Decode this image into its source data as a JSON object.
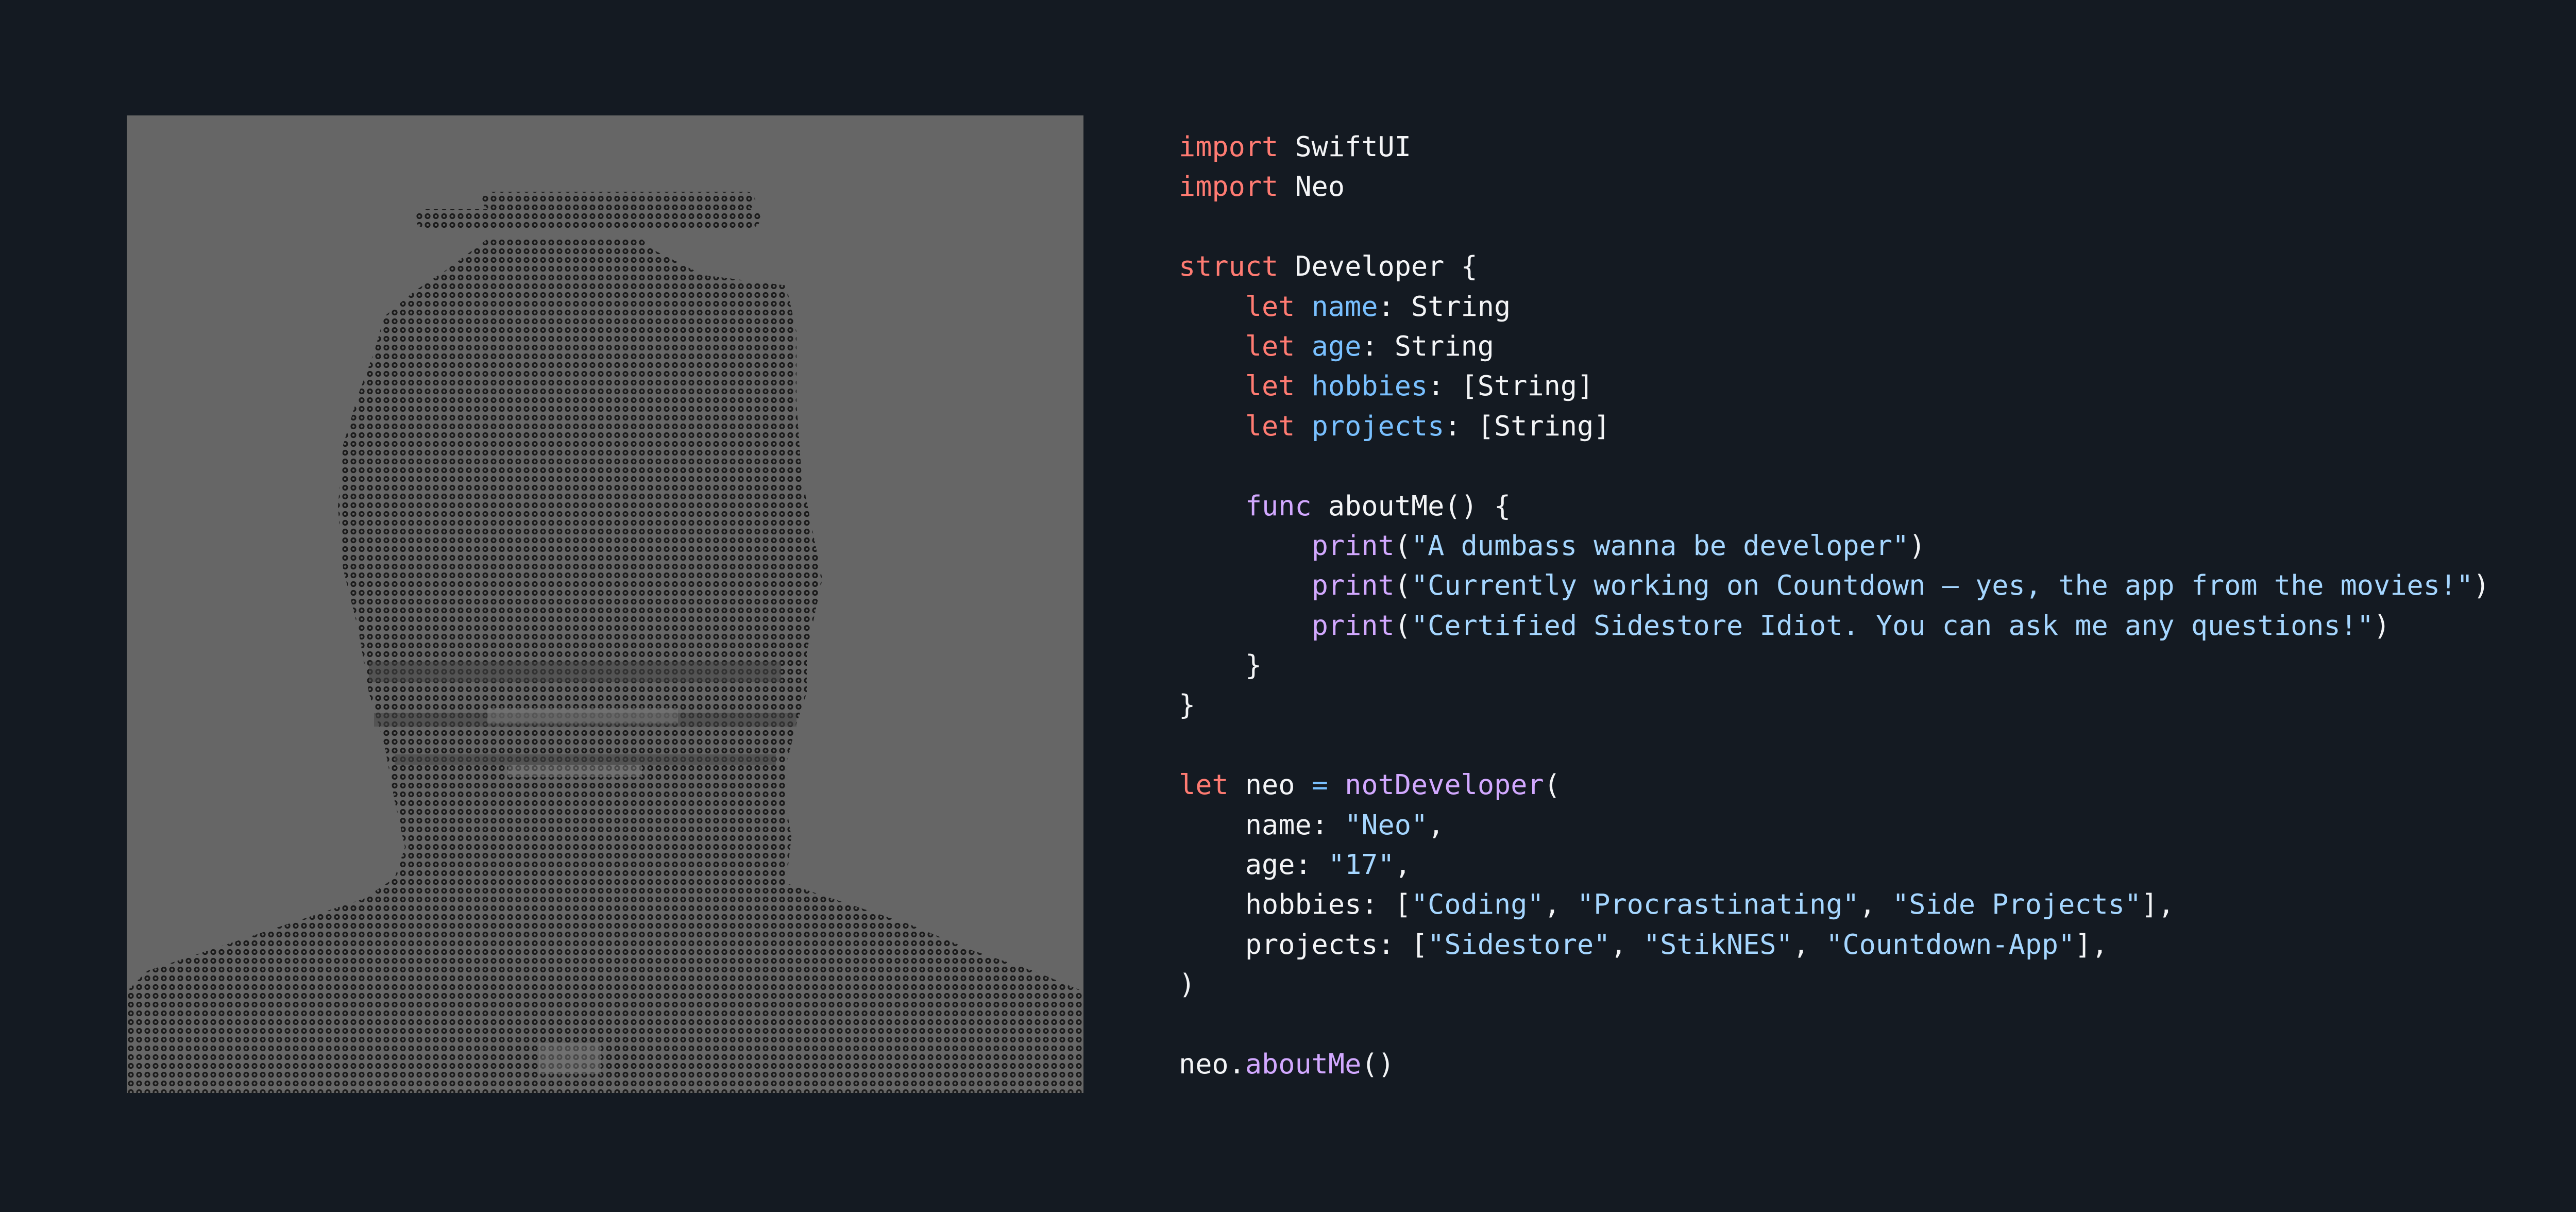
{
  "colors": {
    "background": "#141a22",
    "image_background": "#666666",
    "ascii_art": "#1a1a1a",
    "keyword": "#ff7b72",
    "function": "#d2a8ff",
    "property": "#79c0ff",
    "string": "#a5d6ff",
    "plain": "#f3f4f6"
  },
  "avatar": {
    "kind": "ascii-art-portrait",
    "icon": "ascii-portrait-icon"
  },
  "code": {
    "language": "swift",
    "lines": [
      [
        {
          "t": "import",
          "c": "kw"
        },
        {
          "t": " SwiftUI",
          "c": "plain"
        }
      ],
      [
        {
          "t": "import",
          "c": "kw"
        },
        {
          "t": " Neo",
          "c": "plain"
        }
      ],
      [],
      [
        {
          "t": "struct",
          "c": "kw"
        },
        {
          "t": " Developer {",
          "c": "plain"
        }
      ],
      [
        {
          "t": "    ",
          "c": "plain"
        },
        {
          "t": "let",
          "c": "kw"
        },
        {
          "t": " ",
          "c": "plain"
        },
        {
          "t": "name",
          "c": "prop"
        },
        {
          "t": ": String",
          "c": "plain"
        }
      ],
      [
        {
          "t": "    ",
          "c": "plain"
        },
        {
          "t": "let",
          "c": "kw"
        },
        {
          "t": " ",
          "c": "plain"
        },
        {
          "t": "age",
          "c": "prop"
        },
        {
          "t": ": String",
          "c": "plain"
        }
      ],
      [
        {
          "t": "    ",
          "c": "plain"
        },
        {
          "t": "let",
          "c": "kw"
        },
        {
          "t": " ",
          "c": "plain"
        },
        {
          "t": "hobbies",
          "c": "prop"
        },
        {
          "t": ": [String]",
          "c": "plain"
        }
      ],
      [
        {
          "t": "    ",
          "c": "plain"
        },
        {
          "t": "let",
          "c": "kw"
        },
        {
          "t": " ",
          "c": "plain"
        },
        {
          "t": "projects",
          "c": "prop"
        },
        {
          "t": ": [String]",
          "c": "plain"
        }
      ],
      [],
      [
        {
          "t": "    ",
          "c": "plain"
        },
        {
          "t": "func",
          "c": "fn"
        },
        {
          "t": " aboutMe() {",
          "c": "plain"
        }
      ],
      [
        {
          "t": "        ",
          "c": "plain"
        },
        {
          "t": "print",
          "c": "fn"
        },
        {
          "t": "(",
          "c": "plain"
        },
        {
          "t": "\"A dumbass wanna be developer\"",
          "c": "str"
        },
        {
          "t": ")",
          "c": "plain"
        }
      ],
      [
        {
          "t": "        ",
          "c": "plain"
        },
        {
          "t": "print",
          "c": "fn"
        },
        {
          "t": "(",
          "c": "plain"
        },
        {
          "t": "\"Currently working on Countdown — yes, the app from the movies!\"",
          "c": "str"
        },
        {
          "t": ")",
          "c": "plain"
        }
      ],
      [
        {
          "t": "        ",
          "c": "plain"
        },
        {
          "t": "print",
          "c": "fn"
        },
        {
          "t": "(",
          "c": "plain"
        },
        {
          "t": "\"Certified Sidestore Idiot. You can ask me any questions!\"",
          "c": "str"
        },
        {
          "t": ")",
          "c": "plain"
        }
      ],
      [
        {
          "t": "    }",
          "c": "plain"
        }
      ],
      [
        {
          "t": "}",
          "c": "plain"
        }
      ],
      [],
      [
        {
          "t": "let",
          "c": "kw"
        },
        {
          "t": " neo ",
          "c": "plain"
        },
        {
          "t": "=",
          "c": "prop"
        },
        {
          "t": " ",
          "c": "plain"
        },
        {
          "t": "notDeveloper",
          "c": "fn"
        },
        {
          "t": "(",
          "c": "plain"
        }
      ],
      [
        {
          "t": "    name: ",
          "c": "plain"
        },
        {
          "t": "\"Neo\"",
          "c": "str"
        },
        {
          "t": ",",
          "c": "plain"
        }
      ],
      [
        {
          "t": "    age: ",
          "c": "plain"
        },
        {
          "t": "\"17\"",
          "c": "str"
        },
        {
          "t": ",",
          "c": "plain"
        }
      ],
      [
        {
          "t": "    hobbies: [",
          "c": "plain"
        },
        {
          "t": "\"Coding\"",
          "c": "str"
        },
        {
          "t": ", ",
          "c": "plain"
        },
        {
          "t": "\"Procrastinating\"",
          "c": "str"
        },
        {
          "t": ", ",
          "c": "plain"
        },
        {
          "t": "\"Side Projects\"",
          "c": "str"
        },
        {
          "t": "],",
          "c": "plain"
        }
      ],
      [
        {
          "t": "    projects: [",
          "c": "plain"
        },
        {
          "t": "\"Sidestore\"",
          "c": "str"
        },
        {
          "t": ", ",
          "c": "plain"
        },
        {
          "t": "\"StikNES\"",
          "c": "str"
        },
        {
          "t": ", ",
          "c": "plain"
        },
        {
          "t": "\"Countdown-App\"",
          "c": "str"
        },
        {
          "t": "],",
          "c": "plain"
        }
      ],
      [
        {
          "t": ")",
          "c": "plain"
        }
      ],
      [],
      [
        {
          "t": "neo.",
          "c": "plain"
        },
        {
          "t": "aboutMe",
          "c": "fn"
        },
        {
          "t": "()",
          "c": "plain"
        }
      ]
    ]
  }
}
